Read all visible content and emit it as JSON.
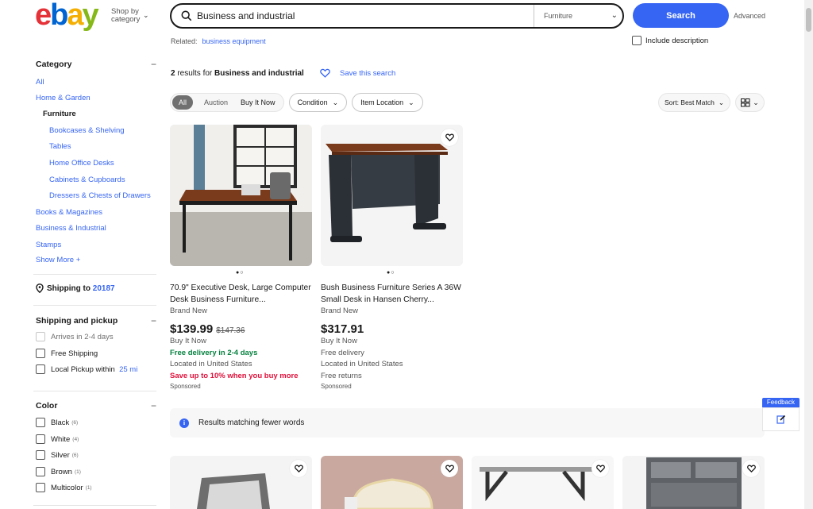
{
  "header": {
    "logo_letters": [
      "e",
      "b",
      "a",
      "y"
    ],
    "shop_by_line1": "Shop by",
    "shop_by_line2": "category",
    "search_value": "Business and industrial",
    "category_select": "Furniture",
    "search_button": "Search",
    "advanced": "Advanced",
    "related_label": "Related:",
    "related_link": "business equipment",
    "include_description": "Include description"
  },
  "sidebar": {
    "category_heading": "Category",
    "categories": [
      {
        "label": "All"
      },
      {
        "label": "Home & Garden"
      },
      {
        "label": "Furniture"
      },
      {
        "label": "Bookcases & Shelving"
      },
      {
        "label": "Tables"
      },
      {
        "label": "Home Office Desks"
      },
      {
        "label": "Cabinets & Cupboards"
      },
      {
        "label": "Dressers & Chests of Drawers"
      },
      {
        "label": "Books & Magazines"
      },
      {
        "label": "Business & Industrial"
      },
      {
        "label": "Stamps"
      },
      {
        "label": "Show More"
      }
    ],
    "shipping_to_label": "Shipping to",
    "shipping_zip": "20187",
    "shipping_heading": "Shipping and pickup",
    "shipping_options": [
      {
        "label": "Arrives in 2-4 days"
      },
      {
        "label": "Free Shipping"
      },
      {
        "label": "Local Pickup within",
        "extra": "25 mi"
      }
    ],
    "color_heading": "Color",
    "colors": [
      {
        "label": "Black",
        "count": "(6)"
      },
      {
        "label": "White",
        "count": "(4)"
      },
      {
        "label": "Silver",
        "count": "(6)"
      },
      {
        "label": "Brown",
        "count": "(1)"
      },
      {
        "label": "Multicolor",
        "count": "(1)"
      }
    ]
  },
  "results": {
    "count": "2",
    "count_suffix": "results for",
    "query": "Business and industrial",
    "save_search": "Save this search",
    "filters": {
      "all": "All",
      "auction": "Auction",
      "buy_it_now": "Buy It Now",
      "condition": "Condition",
      "item_location": "Item Location"
    },
    "sort": "Sort: Best Match",
    "fewer_words": "Results matching fewer words"
  },
  "items": [
    {
      "title": "70.9\" Executive Desk, Large Computer Desk Business Furniture...",
      "condition": "Brand New",
      "price": "$139.99",
      "was_price": "$147.36",
      "format": "Buy It Now",
      "delivery": "Free delivery in 2-4 days",
      "location": "Located in United States",
      "promo": "Save up to 10% when you buy more",
      "sponsored": "Sponsored"
    },
    {
      "title": "Bush Business Furniture Series A 36W Small Desk in Hansen Cherry...",
      "condition": "Brand New",
      "price": "$317.91",
      "format": "Buy It Now",
      "delivery": "Free delivery",
      "location": "Located in United States",
      "returns": "Free returns",
      "sponsored": "Sponsored"
    }
  ],
  "feedback": "Feedback",
  "colors": {
    "accent": "#3665f3",
    "green": "#05823f",
    "red": "#e0103a"
  }
}
